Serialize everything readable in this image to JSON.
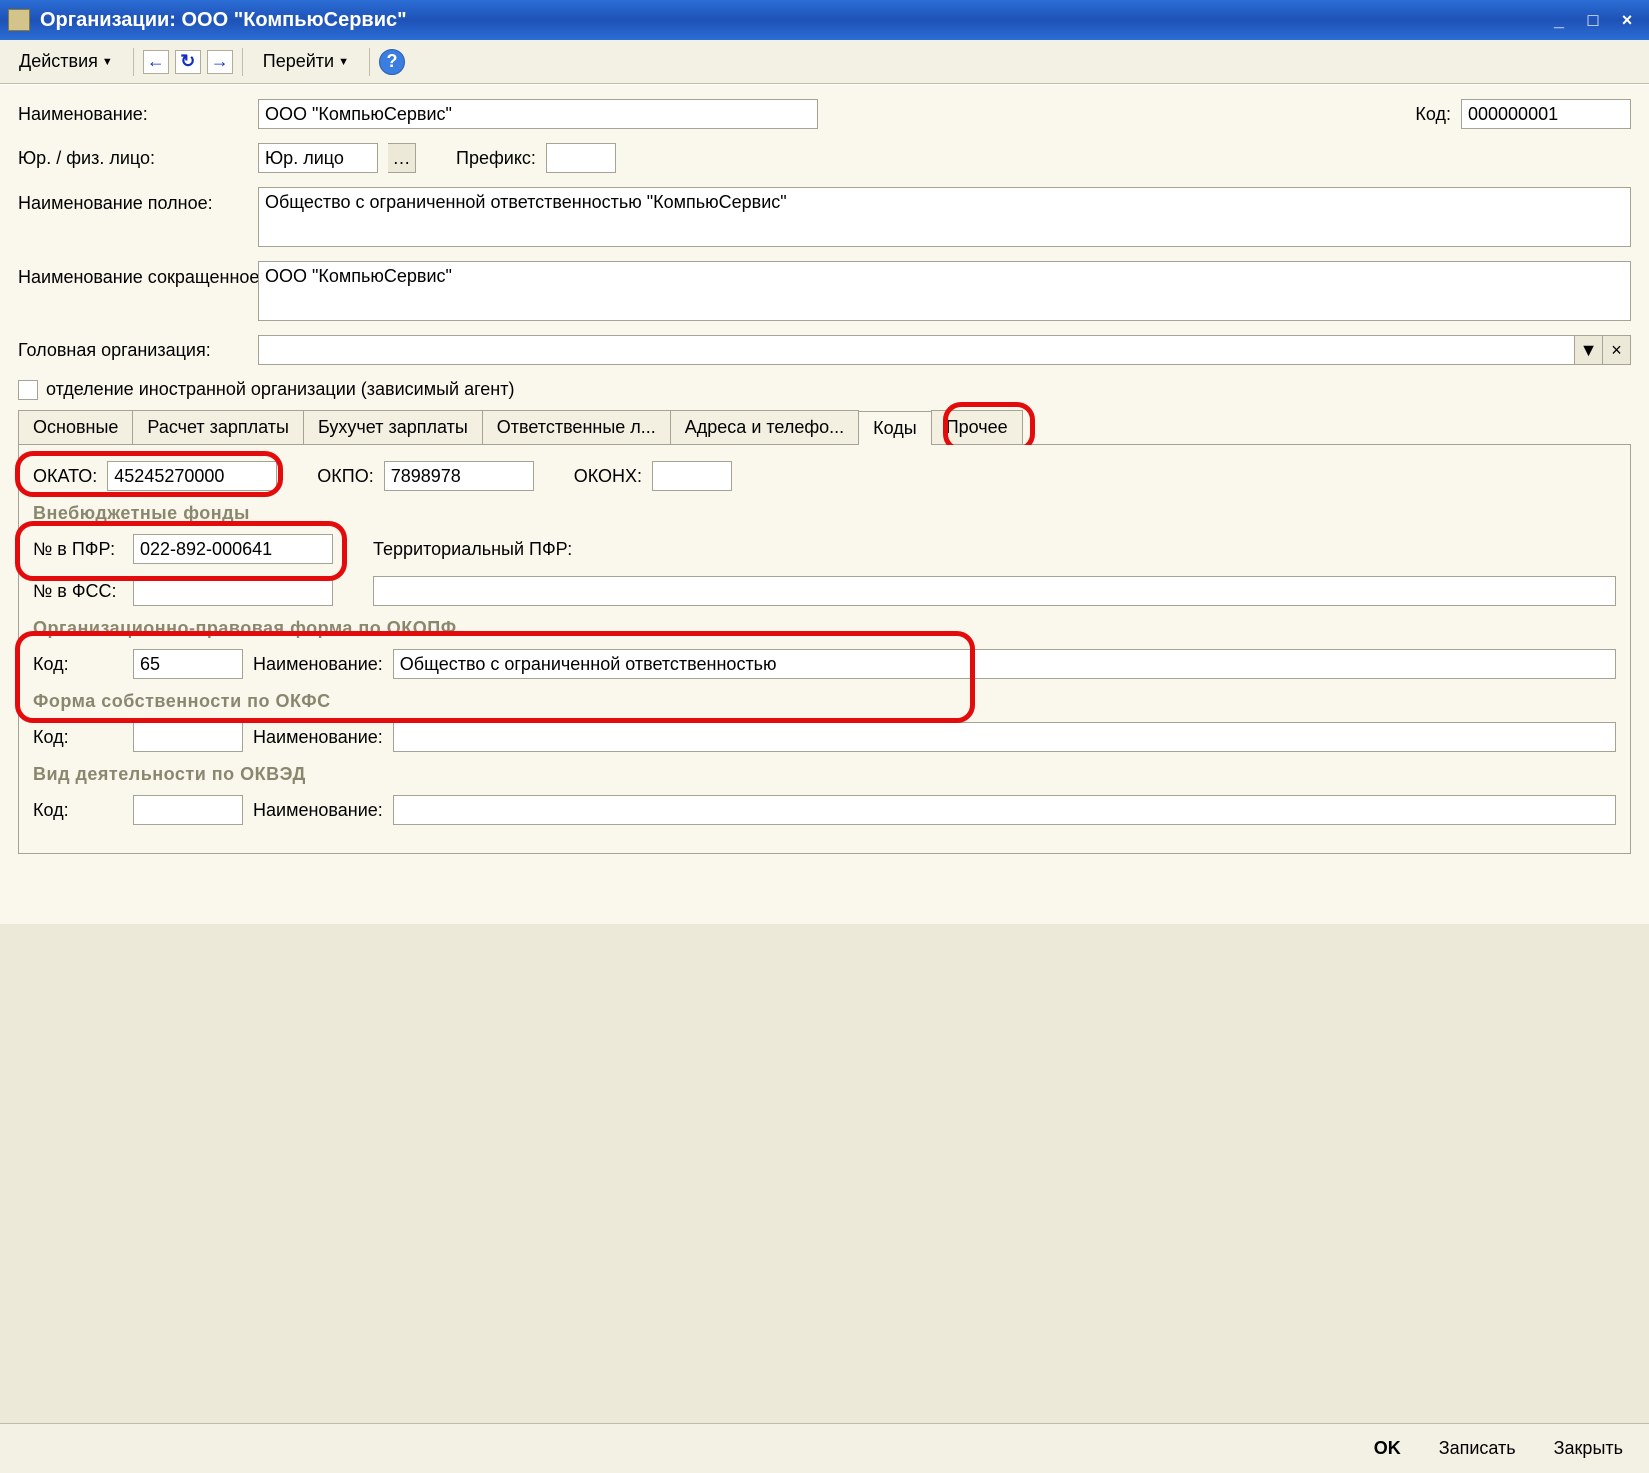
{
  "window": {
    "title": "Организации: ООО \"КомпьюСервис\""
  },
  "toolbar": {
    "actions_label": "Действия",
    "goto_label": "Перейти"
  },
  "form": {
    "name_label": "Наименование:",
    "name_value": "ООО \"КомпьюСервис\"",
    "code_label": "Код:",
    "code_value": "000000001",
    "person_label": "Юр. / физ. лицо:",
    "person_value": "Юр. лицо",
    "prefix_label": "Префикс:",
    "prefix_value": "",
    "fullname_label": "Наименование полное:",
    "fullname_value": "Общество с ограниченной ответственностью \"КомпьюСервис\"",
    "shortname_label": "Наименование сокращенное:",
    "shortname_value": "ООО \"КомпьюСервис\"",
    "parent_label": "Головная организация:",
    "parent_value": "",
    "foreign_dept_label": "отделение иностранной организации (зависимый агент)"
  },
  "tabs": {
    "t1": "Основные",
    "t2": "Расчет зарплаты",
    "t3": "Бухучет зарплаты",
    "t4": "Ответственные л...",
    "t5": "Адреса и телефо...",
    "t6": "Коды",
    "t7": "Прочее"
  },
  "codes": {
    "okato_label": "ОКАТО:",
    "okato_value": "45245270000",
    "okpo_label": "ОКПО:",
    "okpo_value": "7898978",
    "okonh_label": "ОКОНХ:",
    "okonh_value": "",
    "funds_heading": "Внебюджетные фонды",
    "pfr_num_label": "№ в ПФР:",
    "pfr_num_value": "022-892-000641",
    "terr_pfr_label": "Территориальный ПФР:",
    "terr_pfr_value": "",
    "fss_num_label": "№ в ФСС:",
    "fss_num_value": "",
    "okopf_heading": "Организационно-правовая форма по ОКОПФ",
    "okopf_code_label": "Код:",
    "okopf_code_value": "65",
    "okopf_name_label": "Наименование:",
    "okopf_name_value": "Общество с ограниченной ответственностью",
    "okfs_heading": "Форма собственности по ОКФС",
    "okfs_code_label": "Код:",
    "okfs_code_value": "",
    "okfs_name_label": "Наименование:",
    "okfs_name_value": "",
    "okved_heading": "Вид деятельности по ОКВЭД",
    "okved_code_label": "Код:",
    "okved_code_value": "",
    "okved_name_label": "Наименование:",
    "okved_name_value": ""
  },
  "footer": {
    "ok": "OK",
    "save": "Записать",
    "close": "Закрыть"
  }
}
